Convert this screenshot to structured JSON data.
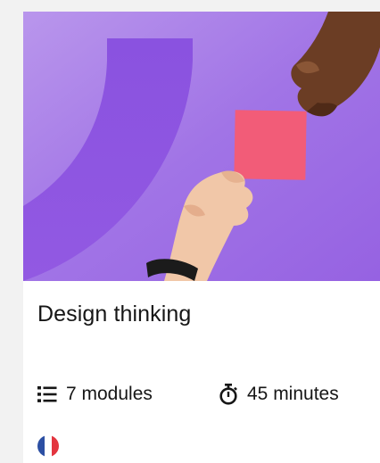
{
  "course": {
    "title": "Design thinking",
    "modules_label": "7 modules",
    "duration_label": "45 minutes",
    "language_flag": "france-flag-icon",
    "colors": {
      "hero_background": "#9f6ee6",
      "hero_arc": "#8a4fe0",
      "sticky_note": "#f25c78",
      "text": "#161616",
      "flag_blue": "#2c4fa3",
      "flag_white": "#ffffff",
      "flag_red": "#e3353f"
    }
  },
  "icons": {
    "modules": "list-icon",
    "duration": "stopwatch-icon"
  }
}
